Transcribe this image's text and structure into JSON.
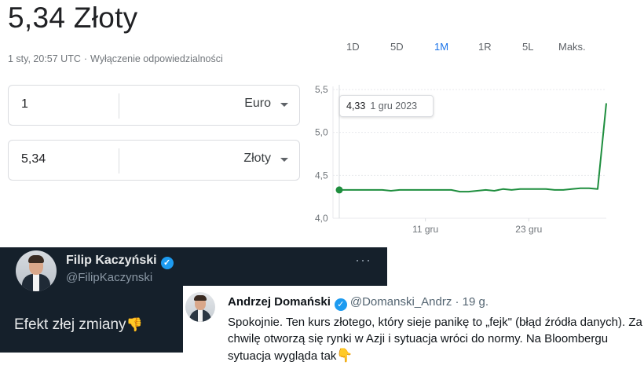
{
  "converter": {
    "headline": "5,34 Złoty",
    "timestamp": "1 sty, 20:57 UTC",
    "separator": "·",
    "disclaimer": "Wyłączenie odpowiedzialności",
    "from": {
      "amount": "1",
      "currency": "Euro"
    },
    "to": {
      "amount": "5,34",
      "currency": "Złoty"
    }
  },
  "chart": {
    "ranges": [
      "1D",
      "5D",
      "1M",
      "1R",
      "5L",
      "Maks."
    ],
    "active_range": "1M",
    "tooltip": {
      "value": "4,33",
      "date": "1 gru 2023"
    },
    "accent_color": "#1e8e3e",
    "active_color": "#1a73e8"
  },
  "chart_data": {
    "type": "line",
    "x": [
      "1 gru",
      "2 gru",
      "3 gru",
      "4 gru",
      "5 gru",
      "6 gru",
      "7 gru",
      "8 gru",
      "9 gru",
      "10 gru",
      "11 gru",
      "12 gru",
      "13 gru",
      "14 gru",
      "15 gru",
      "16 gru",
      "17 gru",
      "18 gru",
      "19 gru",
      "20 gru",
      "21 gru",
      "22 gru",
      "23 gru",
      "24 gru",
      "25 gru",
      "26 gru",
      "27 gru",
      "28 gru",
      "29 gru",
      "30 gru",
      "31 gru",
      "1 sty"
    ],
    "series": [
      {
        "values": [
          4.33,
          4.33,
          4.33,
          4.33,
          4.33,
          4.33,
          4.32,
          4.33,
          4.33,
          4.33,
          4.33,
          4.33,
          4.33,
          4.33,
          4.31,
          4.31,
          4.32,
          4.33,
          4.32,
          4.34,
          4.33,
          4.34,
          4.34,
          4.34,
          4.34,
          4.33,
          4.33,
          4.34,
          4.35,
          4.35,
          4.34,
          5.34
        ]
      }
    ],
    "y_ticks": [
      "4,0",
      "4,5",
      "5,0",
      "5,5"
    ],
    "x_ticks": [
      "11 gru",
      "23 gru"
    ],
    "ylim": [
      4.0,
      5.5
    ],
    "grid": true
  },
  "tweet_dark": {
    "name": "Filip Kaczyński",
    "handle": "@FilipKaczynski",
    "more": "···",
    "text": "Efekt złej zmiany",
    "emoji": "👎"
  },
  "tweet_light": {
    "name": "Andrzej Domański",
    "handle": "@Domanski_Andrz",
    "time": "· 19 g.",
    "text": "Spokojnie. Ten kurs złotego, który sieje panikę to „fejk\" (błąd źródła danych). Za chwilę otworzą się rynki w Azji i sytuacja wróci do normy. Na Bloombergu sytuacja wygląda tak",
    "emoji": "👇"
  }
}
